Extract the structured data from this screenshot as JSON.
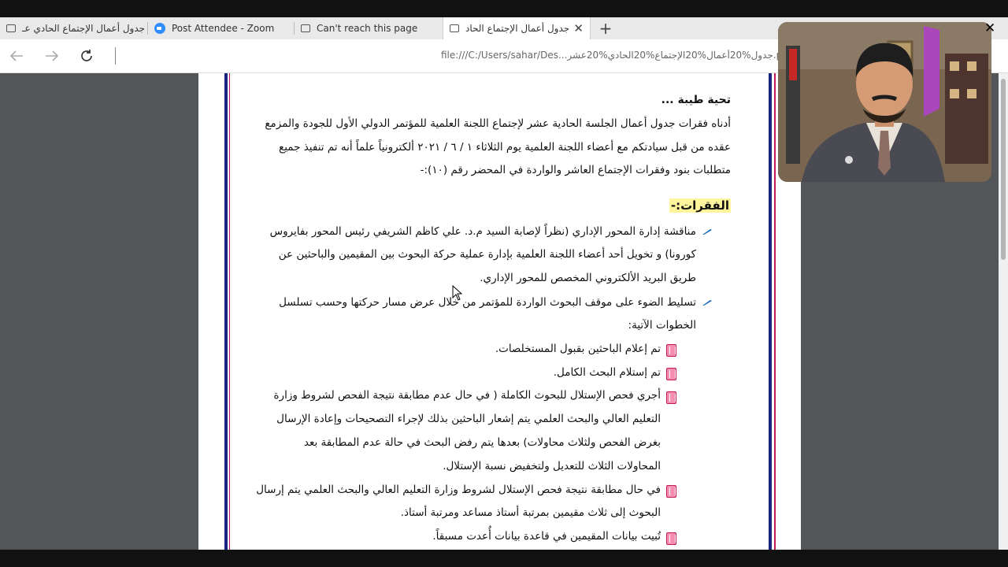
{
  "browser": {
    "tabs": [
      {
        "label": "جدول أعمال الإجتماع الحادي عـ",
        "active": false
      },
      {
        "label": "Post Attendee - Zoom",
        "active": false
      },
      {
        "label": "Can't reach this page",
        "active": false
      },
      {
        "label": "جدول أعمال الإجتماع الحاد",
        "active": true
      }
    ],
    "new_tab": "+",
    "tab_close": "✕",
    "address": "file:///C:/Users/sahar/Des...جدول%20أعمال%20الإجتماع%20الحادي%20عشر.pdf"
  },
  "document": {
    "greeting": "تحية طيبة ...",
    "intro_lines": [
      "أدناه فقرات جدول أعمال الجلسة الحادية عشر لإجتماع اللجنة العلمية للمؤتمر الدولي الأول للجودة والمزمع",
      "عقده من قبل سيادتكم مع أعضاء اللجنة العلمية يوم الثلاثاء ١ / ٦ / ٢٠٢١ ألكترونياً علماً أنه تم تنفيذ جميع",
      "متطلبات بنود وفقرات الإجتماع العاشر والواردة في المحضر رقم (١٠):-"
    ],
    "heading": "الفقرات:-",
    "item1_lines": [
      "مناقشة إدارة المحور الإداري (نظراً لإصابة السيد م.د. علي كاظم الشريفي رئيس المحور بفايروس",
      "كورونا) و تخويل أحد أعضاء اللجنة العلمية بإدارة عملية حركة البحوث بين المقيمين والباحثين عن",
      "طريق البريد الألكتروني المخصص للمحور الإداري."
    ],
    "item2_lines": [
      "تسليط الضوء على موقف البحوث الواردة للمؤتمر من خلال عرض مسار حركتها وحسب تسلسل",
      "الخطوات الآتية:"
    ],
    "sub1": "تم إعلام الباحثين بقبول المستخلصات.",
    "sub2": "تم إستلام البحث الكامل.",
    "sub3_lines": [
      "أجري فحص الإستلال للبحوث الكاملة ( في حال عدم مطابقة نتيجة الفحص لشروط وزارة",
      "التعليم العالي والبحث العلمي يتم إشعار الباحثين بذلك لإجراء التصحيحات وإعادة الإرسال",
      "بغرض الفحص ولثلاث محاولات) بعدها يتم رفض البحث في حالة عدم المطابقة بعد",
      "المحاولات الثلاث للتعديل ولتخفيض نسبة الإستلال."
    ],
    "sub4_lines": [
      "في حال مطابقة نتيجة فحص الإستلال لشروط وزارة التعليم العالي والبحث العلمي يتم إرسال",
      "البحوث إلى ثلاث مقيمين بمرتبة أستاذ مساعد ومرتبة أستاذ."
    ],
    "sub5": "تُبيت بيانات المقيمين في قاعدة بيانات أُعدت مسبقاً."
  },
  "video_overlay": {
    "close": "✕"
  },
  "colors": {
    "page_border_blue": "#1a237e",
    "page_border_pink": "#c2185b",
    "highlight": "#fff59d",
    "viewer_bg": "#525659"
  }
}
